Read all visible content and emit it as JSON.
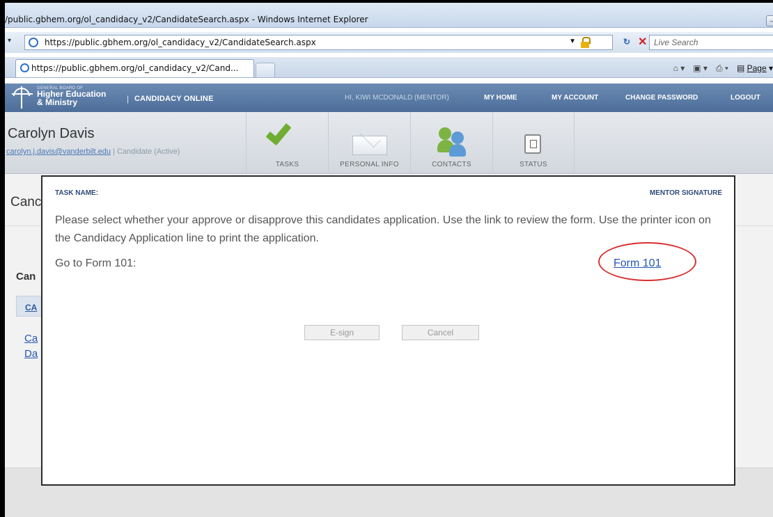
{
  "browser": {
    "title": "/public.gbhem.org/ol_candidacy_v2/CandidateSearch.aspx - Windows Internet Explorer",
    "address": "https://public.gbhem.org/ol_candidacy_v2/CandidateSearch.aspx",
    "search_placeholder": "Live Search",
    "tab_label": "https://public.gbhem.org/ol_candidacy_v2/Cand...",
    "tools": {
      "page_label": "Page"
    }
  },
  "site": {
    "org_small": "GENERAL BOARD OF",
    "org_name": "Higher Education & Ministry",
    "separator": "|",
    "app_name": "CANDIDACY ONLINE",
    "greeting": "HI, KIWI MCDONALD (MENTOR)",
    "nav": [
      "MY HOME",
      "MY ACCOUNT",
      "CHANGE PASSWORD",
      "LOGOUT"
    ]
  },
  "candidate": {
    "name": "Carolyn Davis",
    "email": "carolyn.j.davis@vanderbilt.edu",
    "divider": "|",
    "role": "Candidate (Active)",
    "tiles": [
      "TASKS",
      "PERSONAL INFO",
      "CONTACTS",
      "STATUS"
    ]
  },
  "background": {
    "page_title": "Canc",
    "section_title": "Can",
    "subtab": "CA",
    "links": [
      "Ca",
      "Da"
    ]
  },
  "modal": {
    "task_label": "TASK NAME:",
    "task_value": "MENTOR SIGNATURE",
    "instructions": "Please select whether your approve or disapprove this candidates application. Use the link to review the form. Use the printer icon on the Candidacy Application line to print the application.",
    "goto_label": "Go to Form 101:",
    "form_link": "Form 101",
    "esign_button": "E-sign",
    "cancel_button": "Cancel"
  },
  "colors": {
    "header_blue": "#4d6e99",
    "link_blue": "#2457b5",
    "annotation_red": "#d93030",
    "task_green": "#6fae33"
  }
}
